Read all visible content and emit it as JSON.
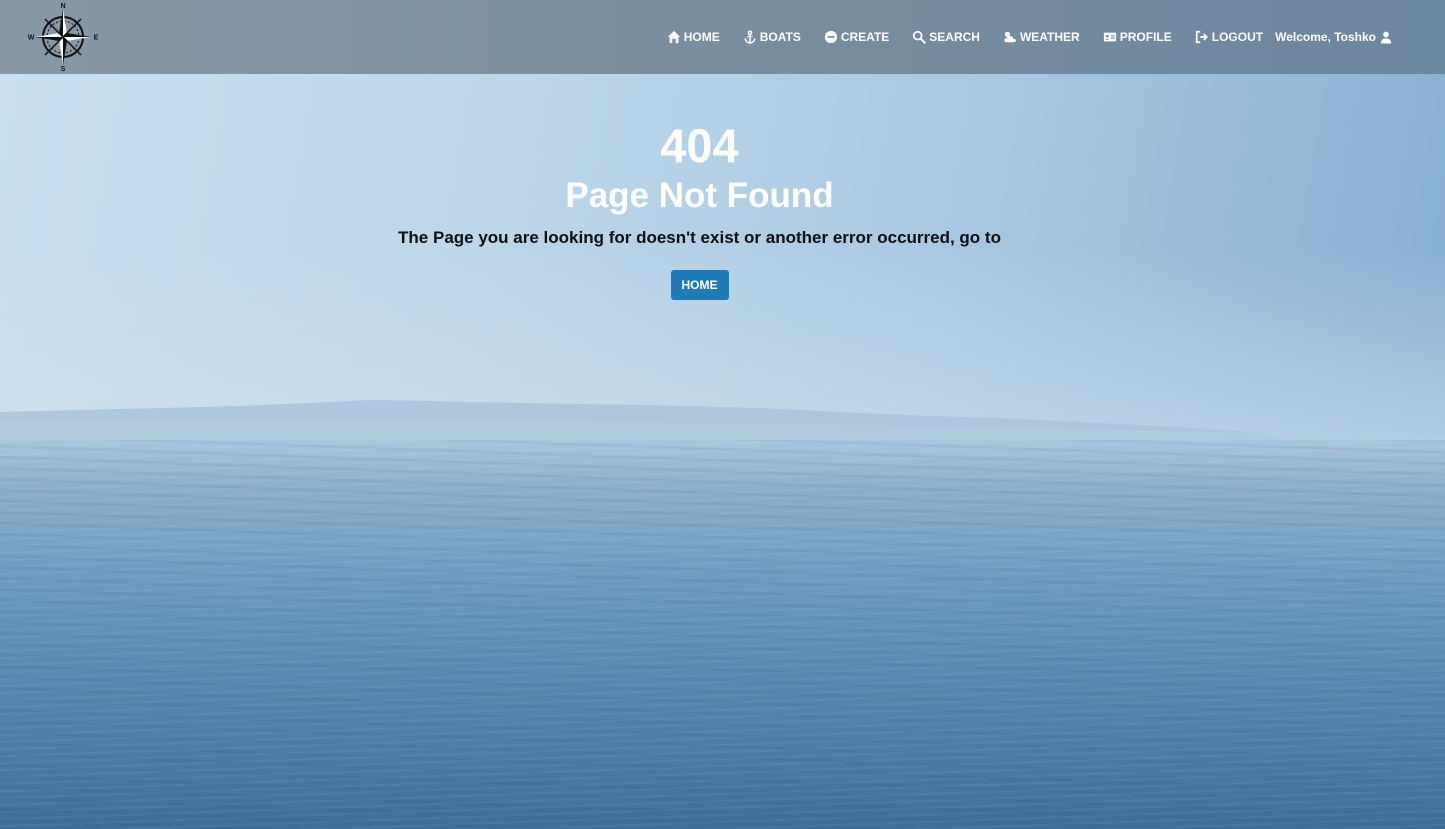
{
  "nav": {
    "items": [
      {
        "label": "HOME",
        "icon": "home-icon"
      },
      {
        "label": "BOATS",
        "icon": "anchor-icon"
      },
      {
        "label": "CREATE",
        "icon": "plus-circle-icon"
      },
      {
        "label": "SEARCH",
        "icon": "search-icon"
      },
      {
        "label": "WEATHER",
        "icon": "cloud-sun-icon"
      },
      {
        "label": "PROFILE",
        "icon": "id-card-icon"
      },
      {
        "label": "LOGOUT",
        "icon": "sign-out-icon"
      }
    ],
    "welcome": "Welcome, Toshko",
    "welcome_icon": "user-icon"
  },
  "logo": {
    "icon": "compass-rose-icon",
    "north": "N",
    "south": "S",
    "east": "E",
    "west": "W"
  },
  "error": {
    "code": "404",
    "title": "Page Not Found",
    "message": "The Page you are looking for doesn't exist or another error occurred, go to",
    "button_label": "HOME"
  },
  "colors": {
    "navbar": "#7a8e9f",
    "button": "#1f7bb5",
    "heading_text": "#ffffff",
    "message_text": "#0d0d12"
  }
}
